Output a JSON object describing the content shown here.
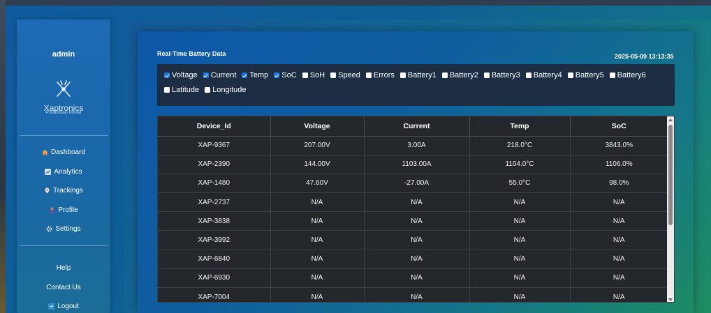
{
  "sidebar": {
    "user": "admin",
    "brand": "Xaptronics",
    "tagline": "Possibilities Infinite",
    "nav": [
      {
        "label": "Dashboard",
        "icon": "home-icon"
      },
      {
        "label": "Analytics",
        "icon": "chart-icon"
      },
      {
        "label": "Trackings",
        "icon": "location-icon"
      },
      {
        "label": "Profile",
        "icon": "user-icon"
      },
      {
        "label": "Settings",
        "icon": "gear-icon"
      }
    ],
    "footer": [
      {
        "label": "Help"
      },
      {
        "label": "Contact Us"
      },
      {
        "label": "Logout",
        "icon": "logout-icon"
      }
    ]
  },
  "content": {
    "title": "Real-Time Battery Data",
    "timestamp": "2025-05-09 13:13:35"
  },
  "filters": {
    "row1": [
      {
        "label": "Voltage",
        "checked": true
      },
      {
        "label": "Current",
        "checked": true
      },
      {
        "label": "Temp",
        "checked": true
      },
      {
        "label": "SoC",
        "checked": true
      },
      {
        "label": "SoH",
        "checked": false
      },
      {
        "label": "Speed",
        "checked": false
      },
      {
        "label": "Errors",
        "checked": false
      },
      {
        "label": "Battery1",
        "checked": false
      },
      {
        "label": "Battery2",
        "checked": false
      },
      {
        "label": "Battery3",
        "checked": false
      },
      {
        "label": "Battery4",
        "checked": false
      },
      {
        "label": "Battery5",
        "checked": false
      },
      {
        "label": "Battery6",
        "checked": false
      }
    ],
    "row2": [
      {
        "label": "Latitude",
        "checked": false
      },
      {
        "label": "Longitude",
        "checked": false
      }
    ]
  },
  "table": {
    "columns": [
      "Device_Id",
      "Voltage",
      "Current",
      "Temp",
      "SoC"
    ],
    "rows": [
      [
        "XAP-9367",
        "207.00V",
        "3.00A",
        "218.0°C",
        "3843.0%"
      ],
      [
        "XAP-2390",
        "144.00V",
        "1103.00A",
        "1104.0°C",
        "1106.0%"
      ],
      [
        "XAP-1480",
        "47.60V",
        "-27.00A",
        "55.0°C",
        "98.0%"
      ],
      [
        "XAP-2737",
        "N/A",
        "N/A",
        "N/A",
        "N/A"
      ],
      [
        "XAP-3838",
        "N/A",
        "N/A",
        "N/A",
        "N/A"
      ],
      [
        "XAP-3992",
        "N/A",
        "N/A",
        "N/A",
        "N/A"
      ],
      [
        "XAP-6840",
        "N/A",
        "N/A",
        "N/A",
        "N/A"
      ],
      [
        "XAP-6930",
        "N/A",
        "N/A",
        "N/A",
        "N/A"
      ],
      [
        "XAP-7004",
        "N/A",
        "N/A",
        "N/A",
        "N/A"
      ]
    ]
  },
  "colors": {
    "checkbox_on": "#1a73e8",
    "table_bg": "#24272c",
    "filter_bg": "#1d2d44"
  }
}
